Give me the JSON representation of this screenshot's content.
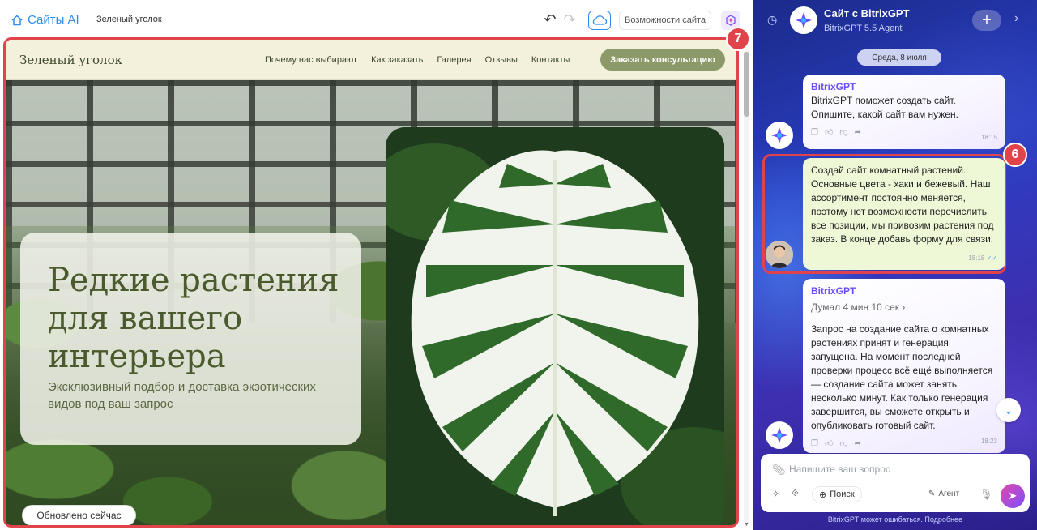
{
  "topbar": {
    "home_label": "Сайты AI",
    "breadcrumb": "Зеленый уголок",
    "features_label": "Возможности сайта"
  },
  "badges": {
    "preview": "7",
    "user_message": "6"
  },
  "site": {
    "logo": "Зеленый уголок",
    "nav_links": [
      "Почему нас выбирают",
      "Как заказать",
      "Галерея",
      "Отзывы",
      "Контакты"
    ],
    "cta": "Заказать консультацию",
    "hero_title": "Редкие растения для вашего интерьера",
    "hero_subtitle": "Эксклюзивный подбор и доставка экзотических видов под ваш запрос",
    "updated": "Обновлено сейчас"
  },
  "chat": {
    "title": "Сайт с BitrixGPT",
    "subtitle": "BitrixGPT 5.5 Agent",
    "date": "Среда, 8 июля",
    "messages": [
      {
        "sender": "BitrixGPT",
        "text": "BitrixGPT поможет создать сайт. Опишите, какой сайт вам нужен.",
        "time": "18:15"
      },
      {
        "text": "Создай сайт комнатный растений. Основные цвета - хаки и бежевый. Наш ассортимент постоянно меняется, поэтому нет возможности перечислить все позиции, мы привозим растения под заказ. В конце добавь форму для связи.",
        "time": "18:18"
      },
      {
        "sender": "BitrixGPT",
        "thinking": "Думал 4 мин 10 сек",
        "text": "Запрос на создание сайта о комнатных растениях принят и генерация запущена. На момент последней проверки процесс всё ещё выполняется — создание сайта может занять несколько минут. Как только генерация завершится, вы сможете открыть и опубликовать готовый сайт.",
        "time": "18:23"
      }
    ],
    "composer": {
      "placeholder": "Напишите ваш вопрос",
      "search_label": "Поиск",
      "agent_label": "Агент"
    },
    "disclaimer": "BitrixGPT может ошибаться. Подробнее"
  },
  "colors": {
    "accent_red": "#e0434a",
    "khaki": "#8c9a6a",
    "beige": "#f3f0dc",
    "chat_bg": "#2b3fc4"
  }
}
